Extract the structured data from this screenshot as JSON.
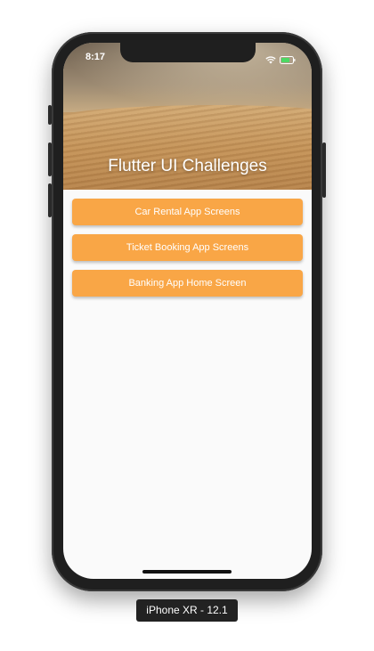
{
  "status_bar": {
    "time": "8:17",
    "icons": [
      "wifi-icon",
      "battery-icon"
    ]
  },
  "header": {
    "title": "Flutter UI Challenges"
  },
  "buttons": [
    {
      "label": "Car Rental App Screens"
    },
    {
      "label": "Ticket Booking App Screens"
    },
    {
      "label": "Banking App Home Screen"
    }
  ],
  "device": {
    "label": "iPhone XR - 12.1"
  },
  "colors": {
    "button": "#f9a646",
    "button_text": "#ffffff",
    "screen_bg": "#fafafa",
    "frame": "#1f1f1f",
    "battery_fill": "#4cd964"
  }
}
